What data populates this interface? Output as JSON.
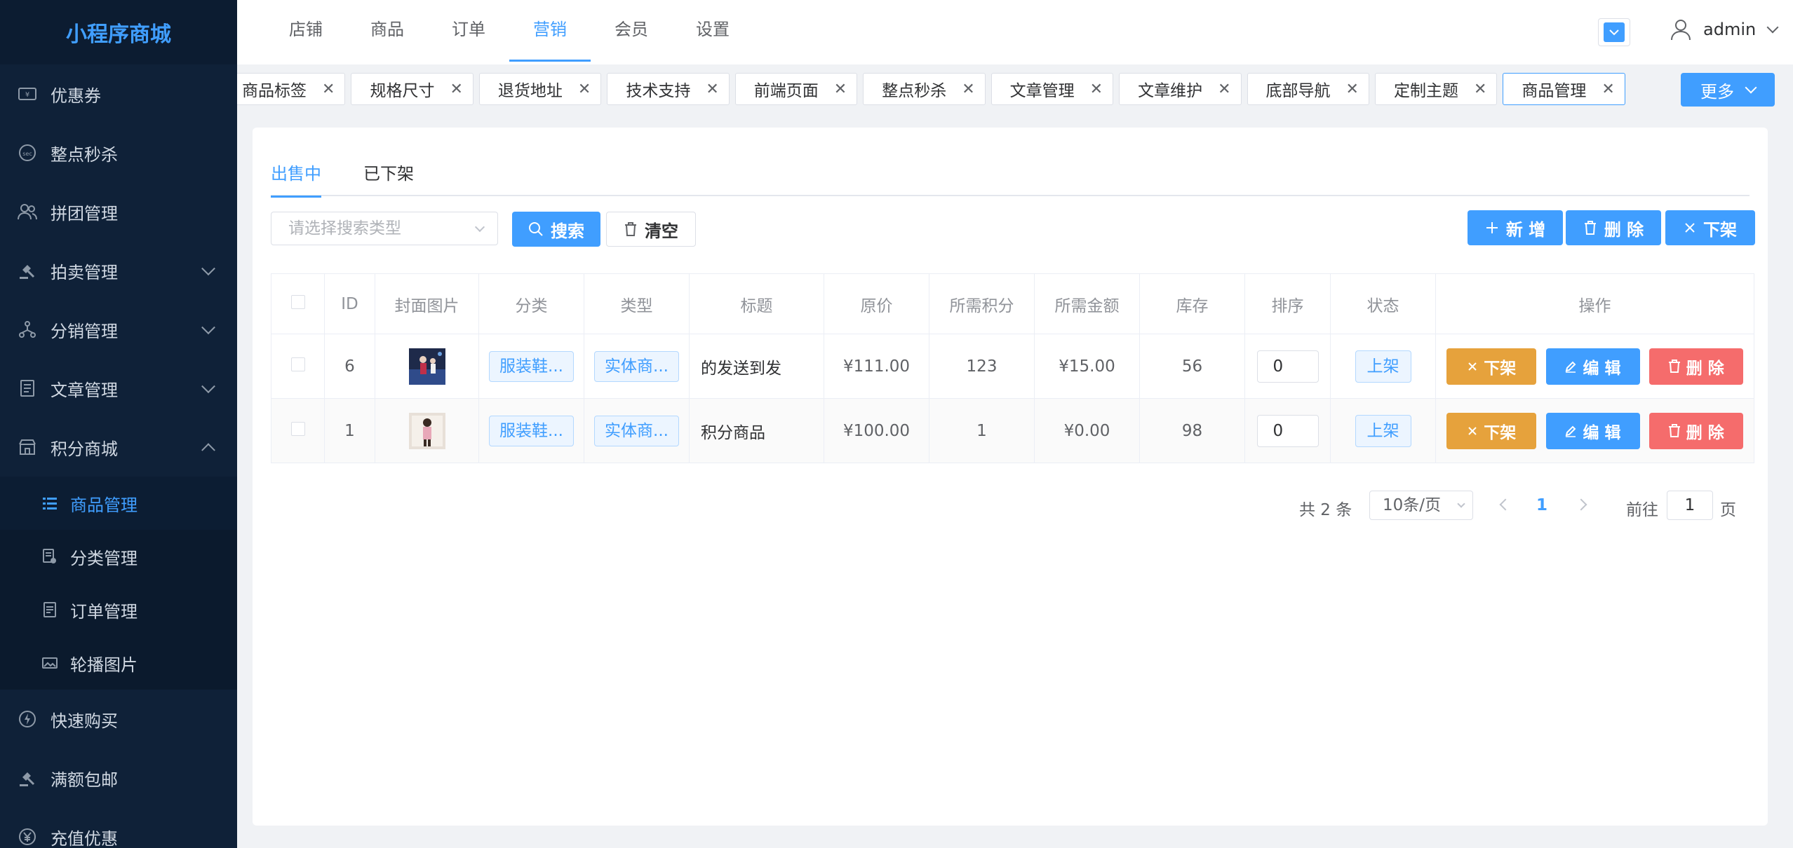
{
  "brand": "小程序商城",
  "sidebar": {
    "items": [
      {
        "label": "优惠券",
        "icon": "coupon-icon"
      },
      {
        "label": "整点秒杀",
        "icon": "seckill-icon"
      },
      {
        "label": "拼团管理",
        "icon": "group-icon"
      },
      {
        "label": "拍卖管理",
        "icon": "auction-icon"
      },
      {
        "label": "分销管理",
        "icon": "distribution-icon"
      },
      {
        "label": "文章管理",
        "icon": "article-icon"
      },
      {
        "label": "积分商城",
        "icon": "store-icon"
      }
    ],
    "submenu": [
      {
        "label": "商品管理",
        "icon": "list-icon"
      },
      {
        "label": "分类管理",
        "icon": "category-icon"
      },
      {
        "label": "订单管理",
        "icon": "order-icon"
      },
      {
        "label": "轮播图片",
        "icon": "image-icon"
      }
    ],
    "after": [
      {
        "label": "快速购买",
        "icon": "lightning-icon"
      },
      {
        "label": "满额包邮",
        "icon": "shipping-icon"
      },
      {
        "label": "充值优惠",
        "icon": "yen-icon"
      }
    ]
  },
  "topnav": [
    "店铺",
    "商品",
    "订单",
    "营销",
    "会员",
    "设置"
  ],
  "user": {
    "name": "admin"
  },
  "tabs": [
    "商品标签",
    "规格尺寸",
    "退货地址",
    "技术支持",
    "前端页面",
    "整点秒杀",
    "文章管理",
    "文章维护",
    "底部导航",
    "定制主题",
    "商品管理"
  ],
  "more": "更多",
  "subtabs": [
    "出售中",
    "已下架"
  ],
  "toolbar": {
    "select_placeholder": "请选择搜索类型",
    "search": "搜索",
    "clear": "清空",
    "add": "新 增",
    "delete": "删 除",
    "offshelf": "下架"
  },
  "table": {
    "headers": [
      "ID",
      "封面图片",
      "分类",
      "类型",
      "标题",
      "原价",
      "所需积分",
      "所需金额",
      "库存",
      "排序",
      "状态",
      "操作"
    ],
    "rows": [
      {
        "id": "6",
        "category": "服装鞋...",
        "type": "实体商...",
        "title": "的发送到发",
        "price": "¥111.00",
        "points": "123",
        "amount": "¥15.00",
        "stock": "56",
        "sort": "0",
        "status": "上架"
      },
      {
        "id": "1",
        "category": "服装鞋...",
        "type": "实体商...",
        "title": "积分商品",
        "price": "¥100.00",
        "points": "1",
        "amount": "¥0.00",
        "stock": "98",
        "sort": "0",
        "status": "上架"
      }
    ],
    "ops": {
      "off": "下架",
      "edit": "编 辑",
      "del": "删 除"
    }
  },
  "pager": {
    "total": "共 2 条",
    "size": "10条/页",
    "current": "1",
    "goto": "前往",
    "page_input": "1",
    "page_unit": "页"
  }
}
